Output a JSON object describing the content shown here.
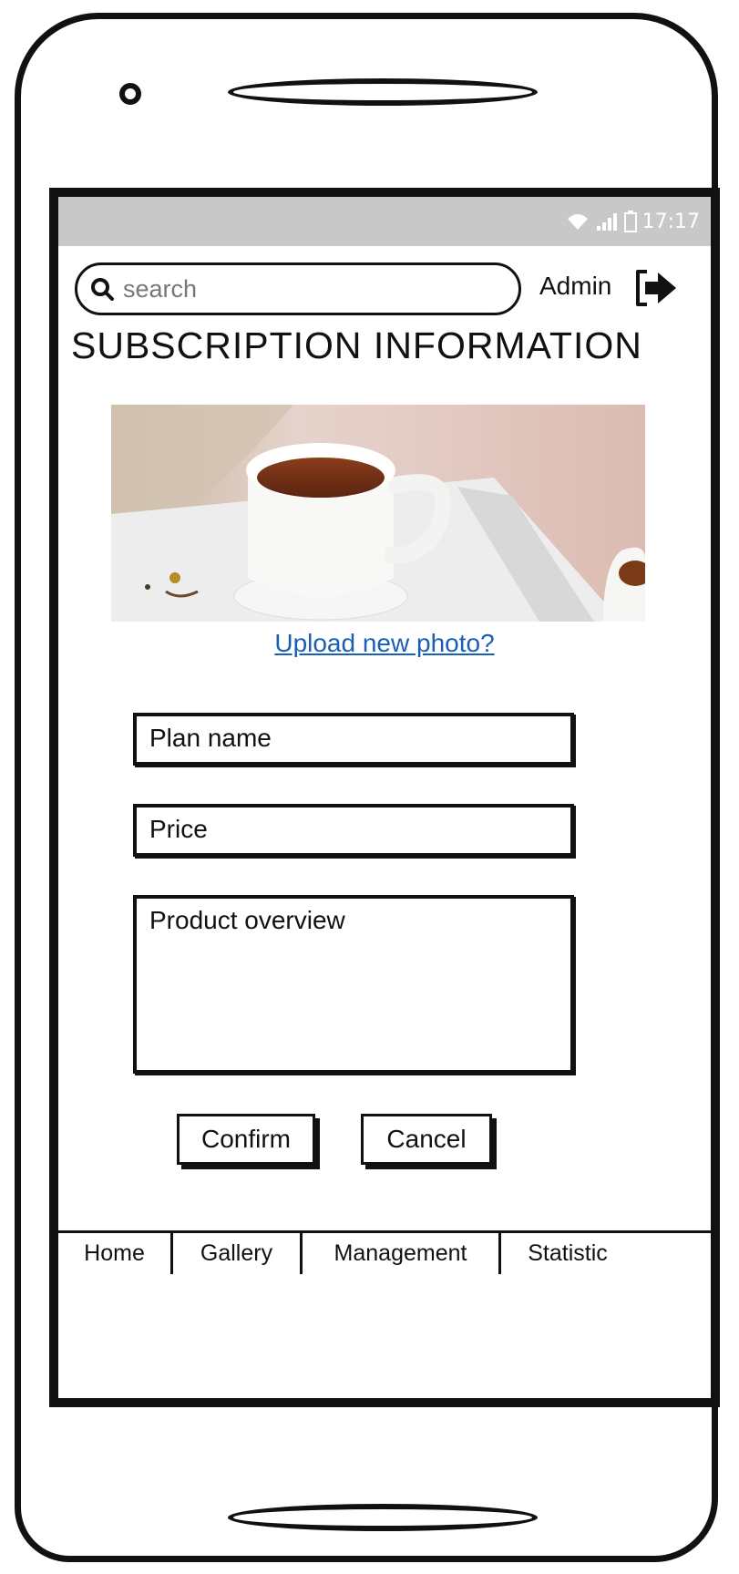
{
  "status_bar": {
    "time": "17:17",
    "icons": [
      "wifi-icon",
      "signal-icon",
      "battery-icon"
    ]
  },
  "header": {
    "search_placeholder": "search",
    "user_name": "Admin",
    "logout_icon": "logout-arrow-icon"
  },
  "page": {
    "title": "SUBSCRIPTION INFORMATION",
    "upload_link": "Upload new photo?"
  },
  "form": {
    "plan_name_placeholder": "Plan name",
    "price_placeholder": "Price",
    "overview_placeholder": "Product overview",
    "confirm_label": "Confirm",
    "cancel_label": "Cancel"
  },
  "tabs": [
    {
      "label": "Home"
    },
    {
      "label": "Gallery"
    },
    {
      "label": "Management"
    },
    {
      "label": "Statistic"
    }
  ],
  "colors": {
    "link": "#1a5fb4",
    "status_bar": "#c8c8c8",
    "outline": "#111111"
  }
}
